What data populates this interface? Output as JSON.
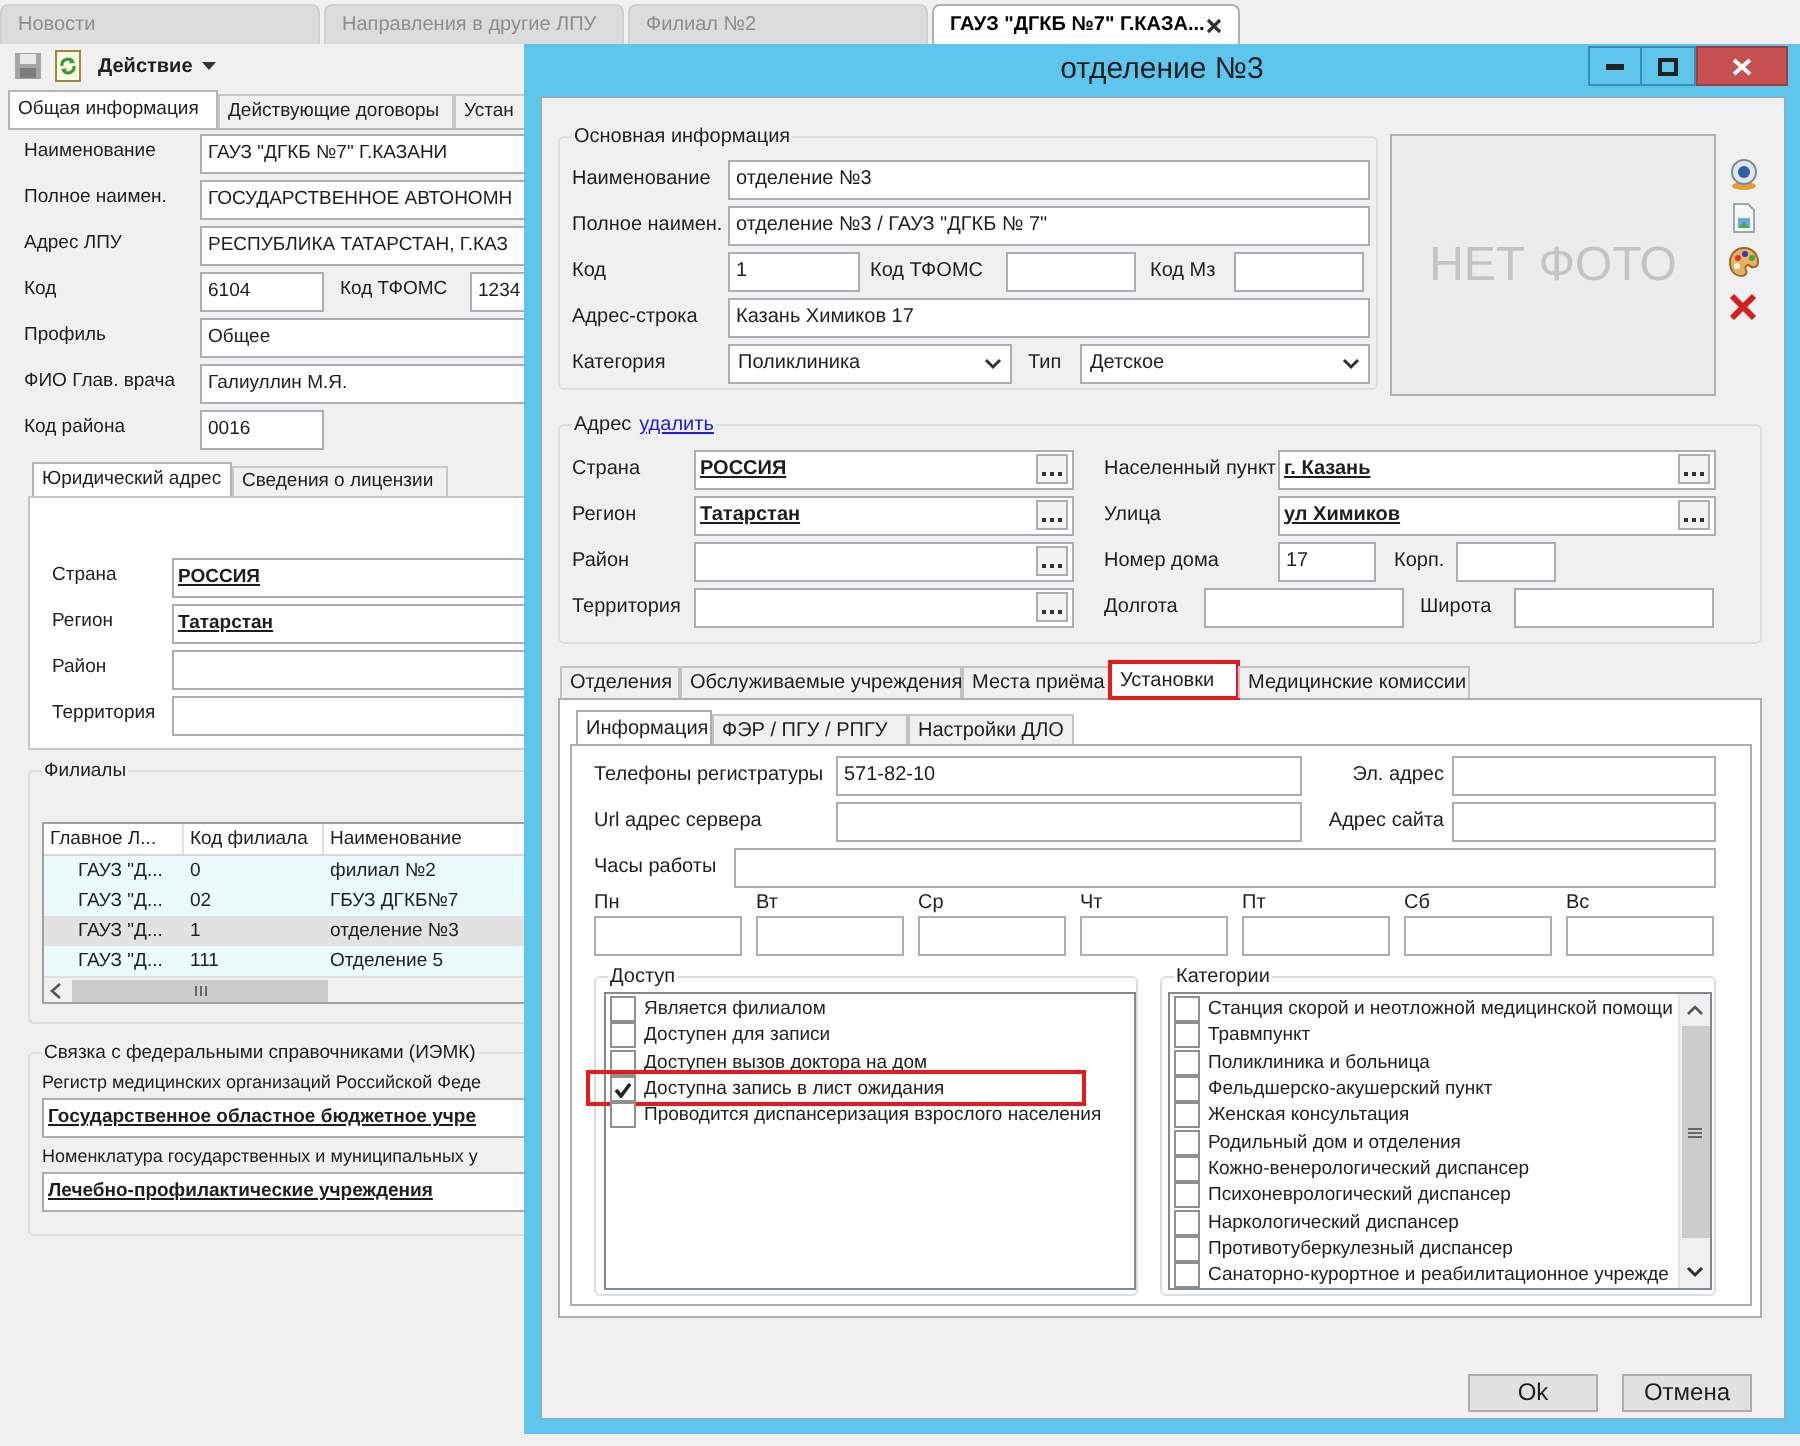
{
  "app_tabs": [
    {
      "label": "Новости",
      "selected": false
    },
    {
      "label": "Направления в другие ЛПУ",
      "selected": false
    },
    {
      "label": "Филиал №2",
      "selected": false
    },
    {
      "label": "ГАУЗ \"ДГКБ №7\" Г.КАЗА...",
      "selected": true
    }
  ],
  "toolbar": {
    "action_menu": "Действие"
  },
  "main_tabs": [
    {
      "label": "Общая информация",
      "selected": true
    },
    {
      "label": "Действующие договоры",
      "selected": false
    },
    {
      "label": "Устан",
      "selected": false
    }
  ],
  "main_fields": [
    {
      "kind": "wide",
      "label": "Наименование",
      "value": "ГАУЗ \"ДГКБ №7\" Г.КАЗАНИ"
    },
    {
      "kind": "wide",
      "label": "Полное наимен.",
      "value": "ГОСУДАРСТВЕННОЕ АВТОНОМН"
    },
    {
      "kind": "wide",
      "label": "Адрес ЛПУ",
      "value": "РЕСПУБЛИКА ТАТАРСТАН, Г.КАЗ"
    },
    {
      "kind": "pair",
      "label": "Код",
      "value": "6104",
      "label_2": "Код ТФОМС",
      "value_2": "1234"
    },
    {
      "kind": "wide",
      "label": "Профиль",
      "value": "Общее"
    },
    {
      "kind": "wide",
      "label": "ФИО Глав. врача",
      "value": "Галиуллин М.Я."
    },
    {
      "kind": "short",
      "label": "Код района",
      "value": "0016"
    }
  ],
  "address_tabs": [
    {
      "label": "Юридический адрес",
      "selected": true
    },
    {
      "label": "Сведения о лицензии",
      "selected": false
    }
  ],
  "legal_address": [
    {
      "label": "Страна",
      "value": "РОССИЯ"
    },
    {
      "label": "Регион",
      "value": "Татарстан"
    },
    {
      "label": "Район"
    },
    {
      "label": "Территория"
    }
  ],
  "branches": {
    "title": "Филиалы",
    "columns": [
      "Главное Л...",
      "Код филиала",
      "Наименование"
    ],
    "rows": [
      {
        "cells": [
          "ГАУЗ \"Д...",
          "0",
          "филиал №2"
        ],
        "selected": false
      },
      {
        "cells": [
          "ГАУЗ \"Д...",
          "02",
          "ГБУЗ ДГКБ№7"
        ],
        "selected": false
      },
      {
        "cells": [
          "ГАУЗ \"Д...",
          "1",
          "отделение №3"
        ],
        "selected": true
      },
      {
        "cells": [
          "ГАУЗ \"Д...",
          "111",
          "Отделение 5"
        ],
        "selected": false
      }
    ]
  },
  "federal_links": {
    "title": "Связка с федеральными справочниками (ИЭМК)",
    "items": [
      {
        "kind": "caption",
        "text": "Регистр медицинских организаций Российской Феде"
      },
      {
        "kind": "lookup",
        "value": "Государственное областное бюджетное учре"
      },
      {
        "kind": "caption",
        "text": "Номенклатура государственных и муниципальных у"
      },
      {
        "kind": "lookup",
        "value": "Лечебно-профилактические учреждения"
      }
    ]
  },
  "dialog": {
    "title": "отделение №3",
    "main_info": {
      "title": "Основная информация",
      "fields": [
        {
          "kind": "text",
          "label": "Наименование",
          "value": "отделение №3"
        },
        {
          "kind": "text",
          "label": "Полное наимен.",
          "value": "отделение №3 / ГАУЗ \"ДГКБ № 7\""
        },
        {
          "kind": "codes",
          "label": "Код",
          "value": "1",
          "label_2": "Код ТФОМС",
          "label_3": "Код Мз"
        },
        {
          "kind": "text",
          "label": "Адрес-строка",
          "value": "Казань Химиков 17"
        },
        {
          "kind": "combos",
          "label": "Категория",
          "value": "Поликлиника",
          "label_2": "Тип",
          "value_2": "Детское"
        }
      ]
    },
    "photo_placeholder": "НЕТ ФОТО",
    "address": {
      "title": "Адрес",
      "delete_link": "удалить",
      "left": [
        {
          "label": "Страна",
          "value": "РОССИЯ"
        },
        {
          "label": "Регион",
          "value": "Татарстан"
        },
        {
          "label": "Район"
        },
        {
          "label": "Территория"
        }
      ],
      "right": [
        {
          "kind": "lookup",
          "label": "Населенный пункт",
          "value": "г. Казань"
        },
        {
          "kind": "lookup",
          "label": "Улица",
          "value": "ул Химиков"
        },
        {
          "kind": "house",
          "label": "Номер дома",
          "value": "17",
          "label_2": "Корп."
        },
        {
          "kind": "coords",
          "label": "Долгота",
          "label_2": "Широта"
        }
      ]
    },
    "tabs": [
      {
        "label": "Отделения",
        "selected": false,
        "highlighted": false
      },
      {
        "label": "Обслуживаемые учреждения",
        "selected": false,
        "highlighted": false
      },
      {
        "label": "Места приёма",
        "selected": false,
        "highlighted": false
      },
      {
        "label": "Установки",
        "selected": true,
        "highlighted": true
      },
      {
        "label": "Медицинские комиссии",
        "selected": false,
        "highlighted": false
      }
    ],
    "subtabs": [
      {
        "label": "Информация",
        "selected": true
      },
      {
        "label": "ФЭР / ПГУ / РПГУ",
        "selected": false
      },
      {
        "label": "Настройки ДЛО",
        "selected": false
      }
    ],
    "info": {
      "phones": {
        "label": "Телефоны регистратуры",
        "value": "571-82-10"
      },
      "email": {
        "label": "Эл. адрес"
      },
      "server_url": {
        "label": "Url адрес сервера"
      },
      "site": {
        "label": "Адрес сайта"
      },
      "hours": {
        "label": "Часы работы"
      },
      "days": [
        "Пн",
        "Вт",
        "Ср",
        "Чт",
        "Пт",
        "Сб",
        "Вс"
      ]
    },
    "access": {
      "title": "Доступ",
      "items": [
        {
          "label": "Является филиалом",
          "checked": false,
          "highlighted": false
        },
        {
          "label": "Доступен для записи",
          "checked": false,
          "highlighted": false
        },
        {
          "label": "Доступен вызов доктора на дом",
          "checked": false,
          "highlighted": false
        },
        {
          "label": "Доступна запись в лист ожидания",
          "checked": true,
          "highlighted": true
        },
        {
          "label": "Проводится диспансеризация взрослого населения",
          "checked": false,
          "highlighted": false
        }
      ]
    },
    "categories": {
      "title": "Категории",
      "items": [
        {
          "label": "Станция скорой и неотложной медицинской помощи",
          "checked": false
        },
        {
          "label": "Травмпункт",
          "checked": false
        },
        {
          "label": "Поликлиника и больница",
          "checked": false
        },
        {
          "label": "Фельдшерско-акушерский пункт",
          "checked": false
        },
        {
          "label": "Женская консультация",
          "checked": false
        },
        {
          "label": "Родильный дом и отделения",
          "checked": false
        },
        {
          "label": "Кожно-венерологический диспансер",
          "checked": false
        },
        {
          "label": "Психоневрологический диспансер",
          "checked": false
        },
        {
          "label": "Наркологический диспансер",
          "checked": false
        },
        {
          "label": "Противотуберкулезный диспансер",
          "checked": false
        },
        {
          "label": "Санаторно-курортное и реабилитационное учрежде",
          "checked": false
        }
      ]
    },
    "buttons": [
      "Ok",
      "Отмена"
    ]
  }
}
